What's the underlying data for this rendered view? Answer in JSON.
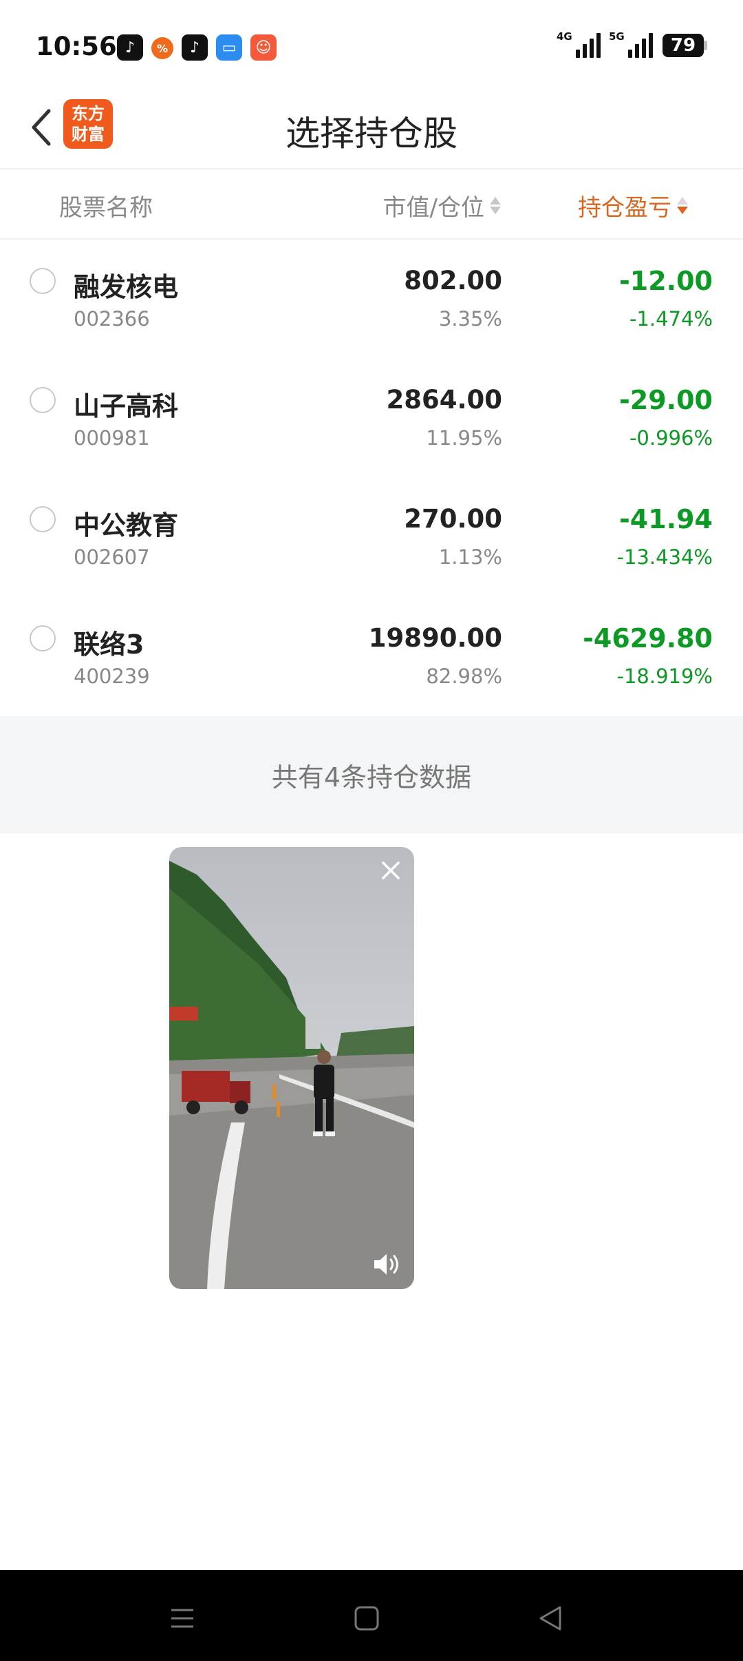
{
  "status_bar": {
    "time": "10:56",
    "net1": "4G",
    "net2": "5G",
    "battery": "79",
    "icons": [
      "tiktok-lite-icon",
      "orange-app-icon",
      "tiktok-icon",
      "files-icon",
      "game-app-icon"
    ]
  },
  "header": {
    "title": "选择持仓股",
    "logo_line1": "东方",
    "logo_line2": "财富"
  },
  "columns": {
    "name": "股票名称",
    "market_value": "市值/仓位",
    "pnl": "持仓盈亏",
    "pnl_sort": "descending"
  },
  "stocks": [
    {
      "name": "融发核电",
      "code": "002366",
      "market_value": "802.00",
      "position": "3.35%",
      "pnl": "-12.00",
      "pnl_pct": "-1.474%"
    },
    {
      "name": "山子高科",
      "code": "000981",
      "market_value": "2864.00",
      "position": "11.95%",
      "pnl": "-29.00",
      "pnl_pct": "-0.996%"
    },
    {
      "name": "中公教育",
      "code": "002607",
      "market_value": "270.00",
      "position": "1.13%",
      "pnl": "-41.94",
      "pnl_pct": "-13.434%"
    },
    {
      "name": "联络3",
      "code": "400239",
      "market_value": "19890.00",
      "position": "82.98%",
      "pnl": "-4629.80",
      "pnl_pct": "-18.919%"
    }
  ],
  "summary": "共有4条持仓数据",
  "colors": {
    "accent_orange": "#d8661e",
    "loss_green": "#0d9a24",
    "logo_orange": "#f05a1c"
  }
}
